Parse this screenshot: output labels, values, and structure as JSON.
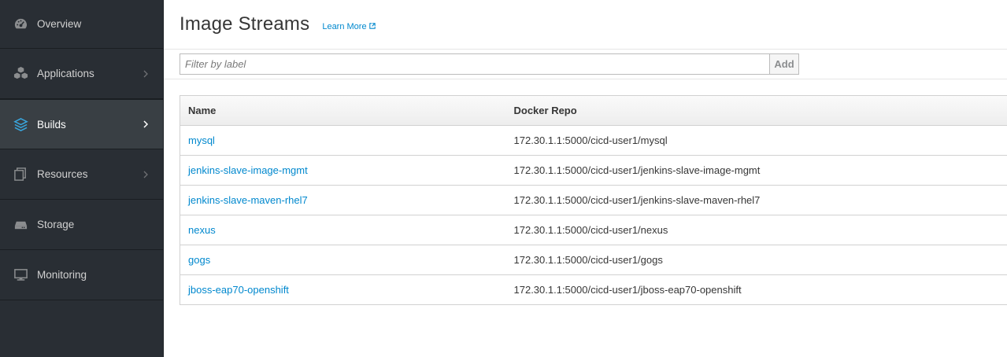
{
  "sidebar": {
    "items": [
      {
        "label": "Overview",
        "icon": "dashboard-icon",
        "chevron": false,
        "active": false
      },
      {
        "label": "Applications",
        "icon": "cubes-icon",
        "chevron": true,
        "active": false
      },
      {
        "label": "Builds",
        "icon": "layers-icon",
        "chevron": true,
        "active": true
      },
      {
        "label": "Resources",
        "icon": "files-icon",
        "chevron": true,
        "active": false
      },
      {
        "label": "Storage",
        "icon": "hard-drive-icon",
        "chevron": false,
        "active": false
      },
      {
        "label": "Monitoring",
        "icon": "monitor-icon",
        "chevron": false,
        "active": false
      }
    ]
  },
  "header": {
    "title": "Image Streams",
    "learn_more": "Learn More"
  },
  "filter": {
    "placeholder": "Filter by label",
    "add_label": "Add"
  },
  "table": {
    "columns": [
      "Name",
      "Docker Repo"
    ],
    "rows": [
      {
        "name": "mysql",
        "repo": "172.30.1.1:5000/cicd-user1/mysql"
      },
      {
        "name": "jenkins-slave-image-mgmt",
        "repo": "172.30.1.1:5000/cicd-user1/jenkins-slave-image-mgmt"
      },
      {
        "name": "jenkins-slave-maven-rhel7",
        "repo": "172.30.1.1:5000/cicd-user1/jenkins-slave-maven-rhel7"
      },
      {
        "name": "nexus",
        "repo": "172.30.1.1:5000/cicd-user1/nexus"
      },
      {
        "name": "gogs",
        "repo": "172.30.1.1:5000/cicd-user1/gogs"
      },
      {
        "name": "jboss-eap70-openshift",
        "repo": "172.30.1.1:5000/cicd-user1/jboss-eap70-openshift"
      }
    ]
  },
  "colors": {
    "sidebar_bg": "#292e34",
    "active_bg": "#393f44",
    "link": "#0088ce",
    "active_icon": "#39a5dc"
  }
}
